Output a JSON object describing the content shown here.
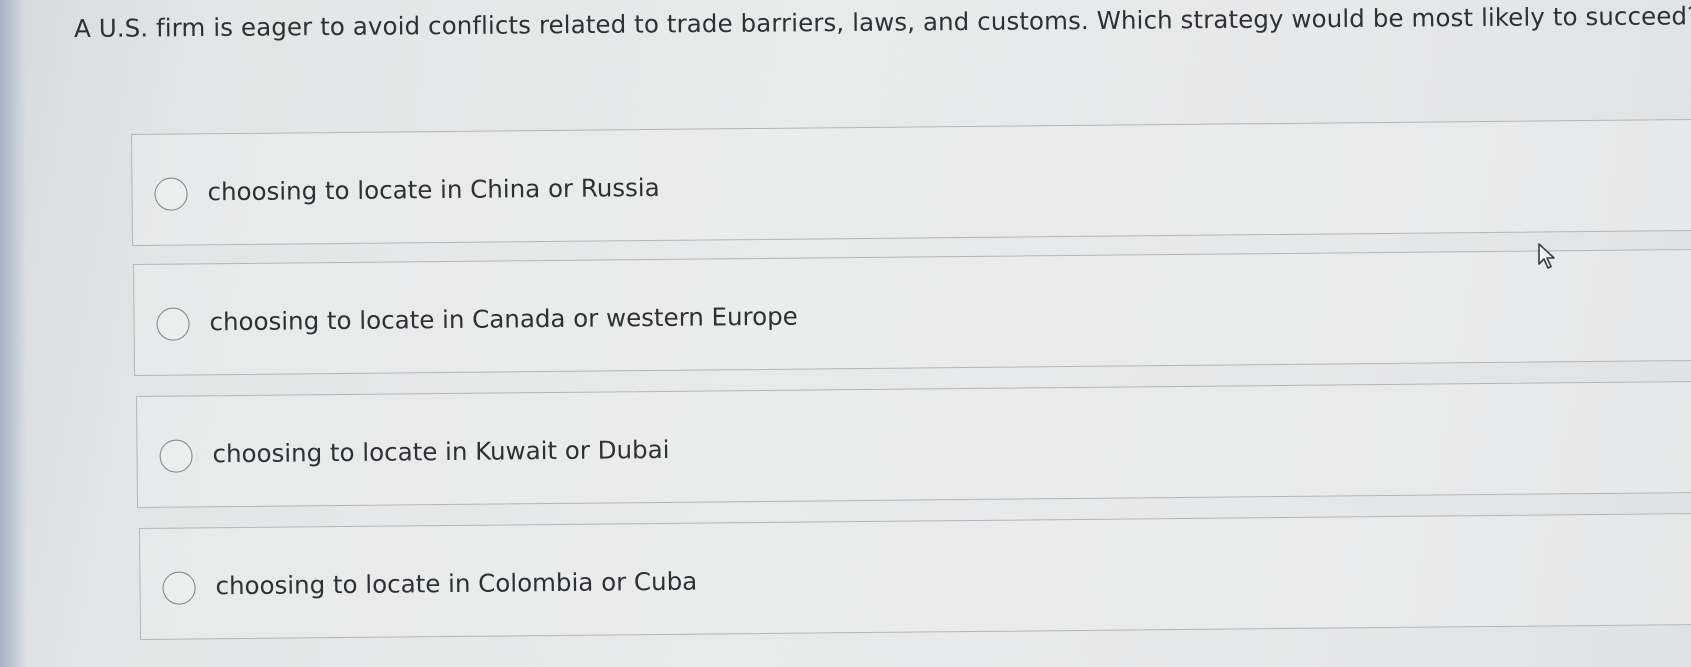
{
  "question": {
    "text": "A U.S. firm is eager to avoid conflicts related to trade barriers, laws, and customs. Which strategy would be most likely to succeed?"
  },
  "options": [
    {
      "label": "choosing to locate in China or Russia",
      "selected": false
    },
    {
      "label": "choosing to locate in Canada or western Europe",
      "selected": false
    },
    {
      "label": "choosing to locate in Kuwait or Dubai",
      "selected": false
    },
    {
      "label": "choosing to locate in Colombia or Cuba",
      "selected": false
    }
  ],
  "icons": {
    "radio": "radio-unchecked-icon",
    "cursor": "mouse-pointer-icon"
  },
  "colors": {
    "text": "#2d3034",
    "border": "#b2b6ba",
    "background": "#e8e9e9"
  }
}
